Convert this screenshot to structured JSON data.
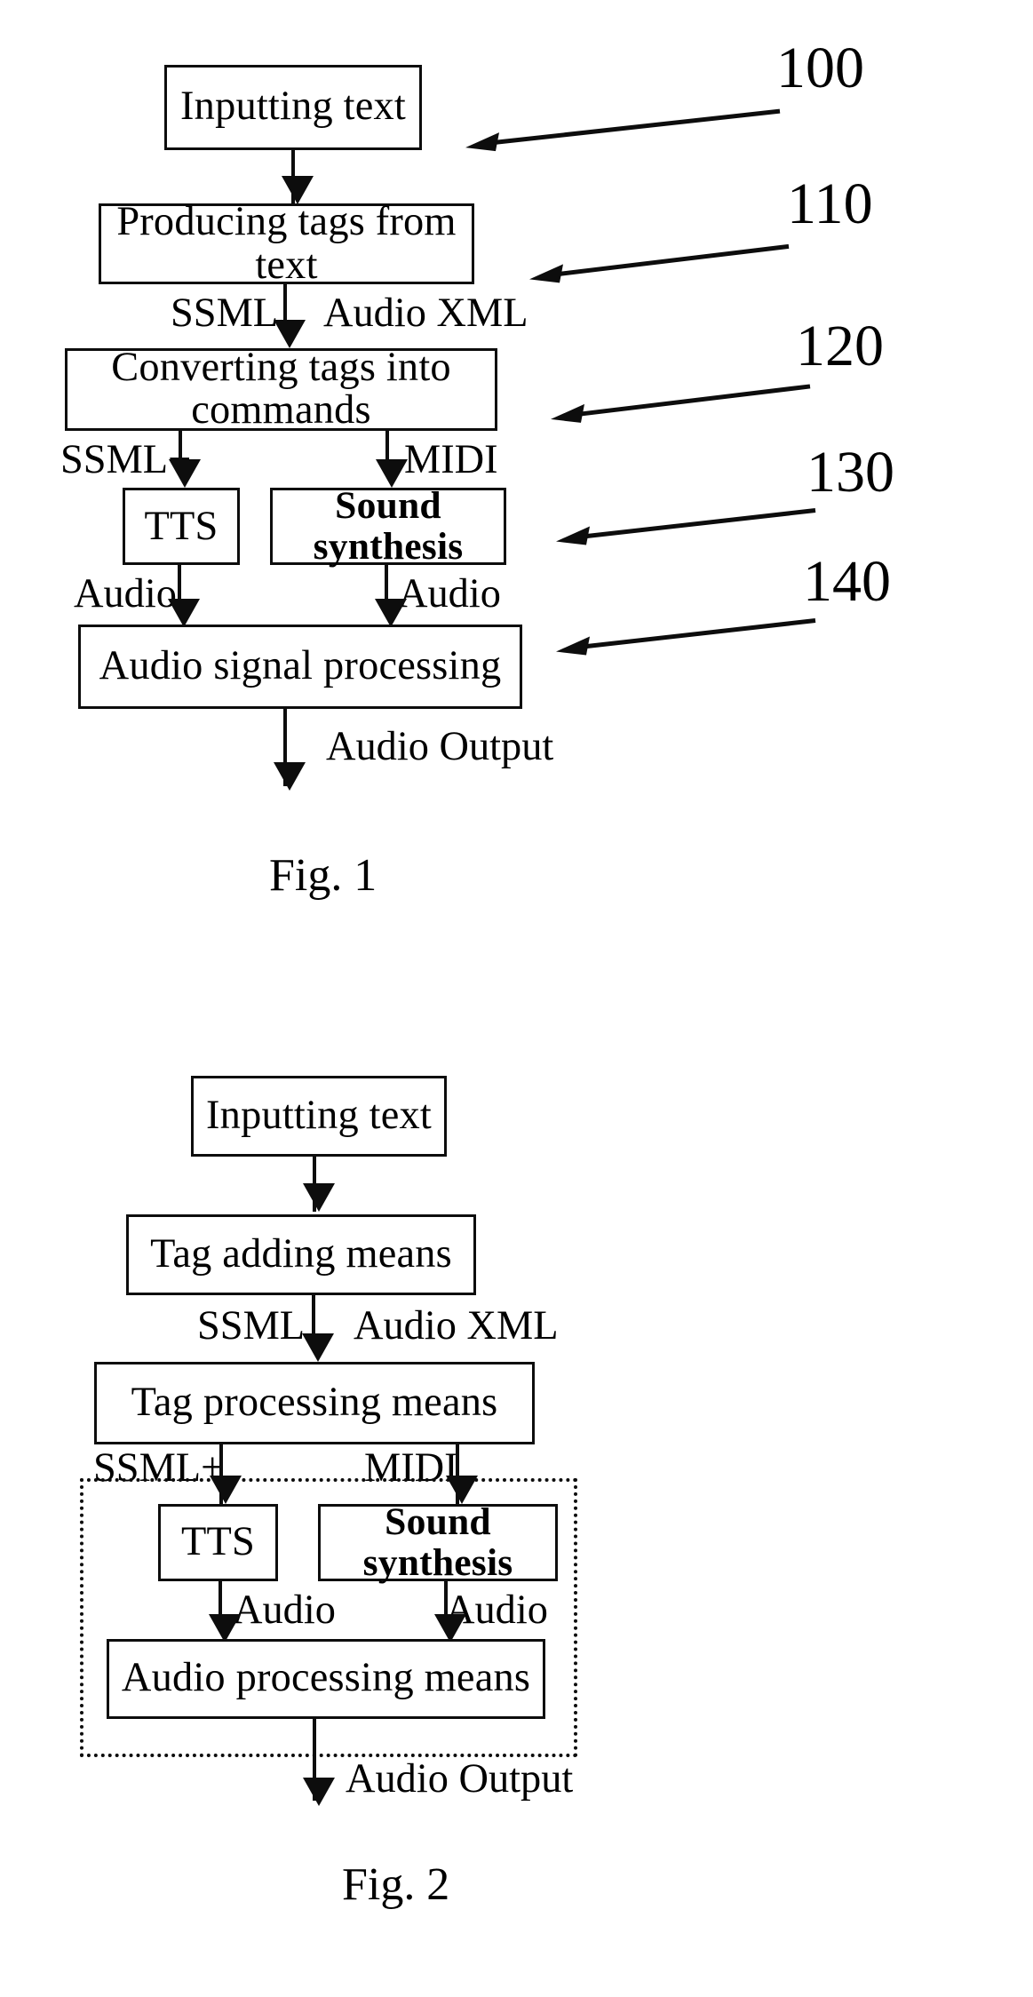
{
  "document": {
    "kind": "patent-drawing-sheet",
    "figures": [
      "Fig. 1",
      "Fig. 2"
    ]
  },
  "figure1": {
    "caption": "Fig. 1",
    "boxes": [
      {
        "id": "inputting-text",
        "label": "Inputting text"
      },
      {
        "id": "producing-tags",
        "label": "Producing tags from text"
      },
      {
        "id": "converting-tags",
        "label": "Converting tags into commands"
      },
      {
        "id": "tts",
        "label": "TTS"
      },
      {
        "id": "sound-synthesis",
        "label": "Sound synthesis"
      },
      {
        "id": "audio-signal-processing",
        "label": "Audio signal processing"
      }
    ],
    "edge_labels": {
      "ssml": "SSML",
      "audio_xml": "Audio XML",
      "ssml_plus": "SSML+",
      "midi": "MIDI",
      "audio_left": "Audio",
      "audio_right": "Audio",
      "audio_output": "Audio Output"
    },
    "reference_numerals": [
      {
        "value": "100",
        "points_to": "Inputting text"
      },
      {
        "value": "110",
        "points_to": "Producing tags from text"
      },
      {
        "value": "120",
        "points_to": "Converting tags into commands"
      },
      {
        "value": "130",
        "points_to": "Sound synthesis"
      },
      {
        "value": "140",
        "points_to": "Audio signal processing"
      }
    ]
  },
  "figure2": {
    "caption": "Fig. 2",
    "boxes": [
      {
        "id": "inputting-text-2",
        "label": "Inputting text"
      },
      {
        "id": "tag-adding-means",
        "label": "Tag adding means"
      },
      {
        "id": "tag-processing-means",
        "label": "Tag processing means"
      },
      {
        "id": "tts-2",
        "label": "TTS"
      },
      {
        "id": "sound-synthesis-2",
        "label": "Sound synthesis"
      },
      {
        "id": "audio-processing-means",
        "label": "Audio processing means"
      }
    ],
    "edge_labels": {
      "ssml": "SSML",
      "audio_xml": "Audio XML",
      "ssml_plus": "SSML+",
      "midi": "MIDI",
      "audio_left": "Audio",
      "audio_right": "Audio",
      "audio_output": "Audio Output"
    },
    "grouping": {
      "style": "dotted",
      "label": ""
    }
  },
  "colors": {
    "ink": "#0d0d0d",
    "paper": "#ffffff"
  }
}
